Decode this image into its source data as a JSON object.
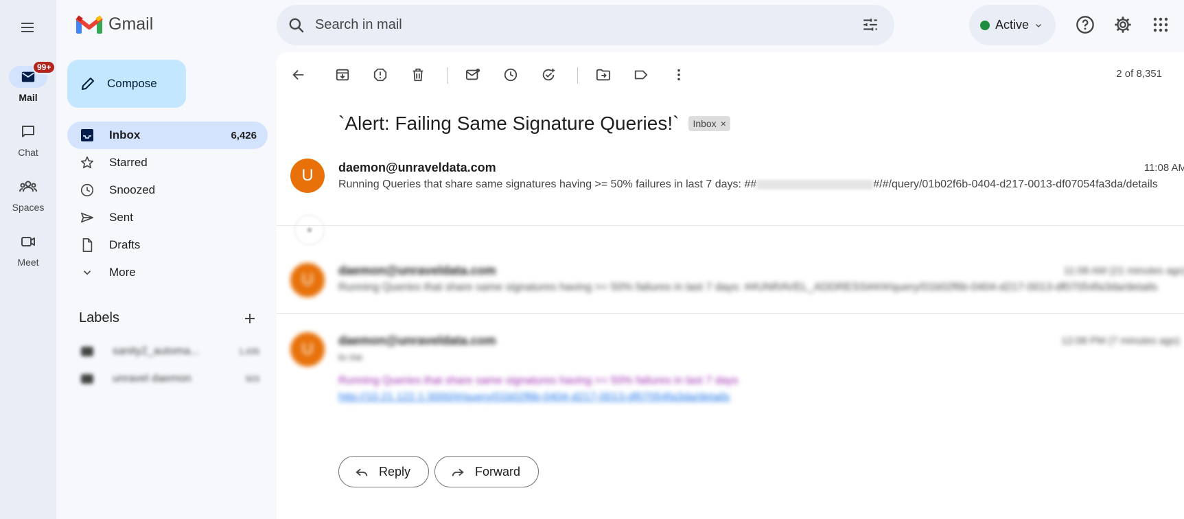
{
  "app": {
    "name": "Gmail"
  },
  "rail": {
    "items": [
      {
        "label": "Mail",
        "badge": "99+",
        "icon": "mail-icon"
      },
      {
        "label": "Chat",
        "icon": "chat-icon"
      },
      {
        "label": "Spaces",
        "icon": "spaces-icon"
      },
      {
        "label": "Meet",
        "icon": "meet-icon"
      }
    ]
  },
  "nav": {
    "compose_label": "Compose",
    "items": [
      {
        "label": "Inbox",
        "count": "6,426",
        "icon": "inbox-icon"
      },
      {
        "label": "Starred",
        "icon": "star-icon"
      },
      {
        "label": "Snoozed",
        "icon": "clock-icon"
      },
      {
        "label": "Sent",
        "icon": "send-icon"
      },
      {
        "label": "Drafts",
        "icon": "draft-icon"
      },
      {
        "label": "More",
        "icon": "chevron-down-icon"
      }
    ],
    "labels_heading": "Labels",
    "labels": [
      {
        "label": "sanity2_automa...",
        "count": "1,435"
      },
      {
        "label": "unravel daemon",
        "count": "503"
      }
    ]
  },
  "search": {
    "placeholder": "Search in mail"
  },
  "status": {
    "label": "Active"
  },
  "toolbar": {
    "pager": "2 of 8,351"
  },
  "thread": {
    "subject": "`Alert: Failing Same Signature Queries!`",
    "tag": "Inbox",
    "messages": [
      {
        "avatar": "U",
        "from": "daemon@unraveldata.com",
        "time": "11:08 AM",
        "snippet_a": "Running Queries that share same signatures having >= 50% failures in last 7 days: ##",
        "snippet_b": "#/#/query/01b02f6b-0404-d217-0013-df07054fa3da/details"
      },
      {
        "avatar": "U",
        "from": "daemon@unraveldata.com",
        "time": "11:08 AM (21 minutes ago)",
        "snippet": "Running Queries that share same signatures having >= 50% failures in last 7 days: ##UNRAVEL_ADDRESS##/#/query/01b02f6b-0404-d217-0013-df07054fa3da/details"
      },
      {
        "avatar": "U",
        "from": "daemon@unraveldata.com",
        "time": "12:08 PM (7 minutes ago)",
        "to": "to me",
        "body_line": "Running Queries that share same signatures having >= 50% failures in last 7 days",
        "body_link": "http://10.21.122.1:3000/#/query/01b02f6b-0404-d217-0013-df07054fa3da/details"
      }
    ]
  },
  "actions": {
    "reply": "Reply",
    "forward": "Forward"
  },
  "colors": {
    "avatar": "#e8710a",
    "compose": "#c2e7ff",
    "active_nav": "#d3e3fd",
    "status_dot": "#1e8e3e",
    "badge": "#b3261e"
  }
}
